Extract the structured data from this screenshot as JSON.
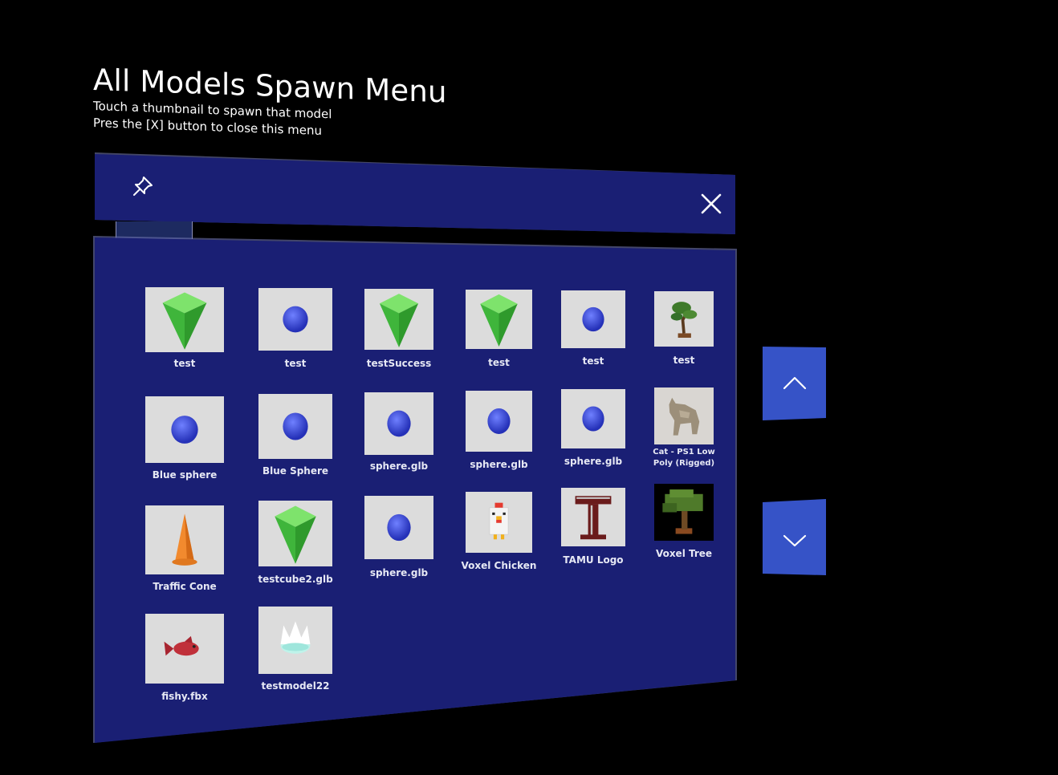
{
  "menu": {
    "title": "All Models Spawn Menu",
    "instructions": [
      "Touch a thumbnail to spawn that model",
      "Pres the [X] button to close this menu"
    ]
  },
  "header": {
    "pin_icon": "pin-icon",
    "close_icon": "close-icon"
  },
  "colors": {
    "panel": "#1a1f74",
    "thumbnail_bg": "#dcdcdc",
    "scroll_button": "#3653c7",
    "cube_green": "#4fd04a",
    "sphere_blue": "#3b4fd8"
  },
  "models": [
    {
      "label": "test",
      "icon": "green-cube-icon"
    },
    {
      "label": "test",
      "icon": "blue-sphere-icon"
    },
    {
      "label": "testSuccess",
      "icon": "green-cube-icon"
    },
    {
      "label": "test",
      "icon": "green-cube-icon"
    },
    {
      "label": "test",
      "icon": "blue-sphere-icon"
    },
    {
      "label": "test",
      "icon": "bonsai-tree-icon"
    },
    {
      "label": "Blue sphere",
      "icon": "blue-sphere-icon"
    },
    {
      "label": "Blue Sphere",
      "icon": "blue-sphere-icon"
    },
    {
      "label": "sphere.glb",
      "icon": "blue-sphere-icon"
    },
    {
      "label": "sphere.glb",
      "icon": "blue-sphere-icon"
    },
    {
      "label": "sphere.glb",
      "icon": "blue-sphere-icon"
    },
    {
      "label": "Cat - PS1 Low Poly (Rigged)",
      "icon": "cat-icon"
    },
    {
      "label": "Traffic Cone",
      "icon": "traffic-cone-icon"
    },
    {
      "label": "testcube2.glb",
      "icon": "green-cube-icon"
    },
    {
      "label": "sphere.glb",
      "icon": "blue-sphere-icon"
    },
    {
      "label": "Voxel Chicken",
      "icon": "voxel-chicken-icon"
    },
    {
      "label": "TAMU Logo",
      "icon": "tamu-logo-icon"
    },
    {
      "label": "Voxel Tree",
      "icon": "voxel-tree-icon"
    },
    {
      "label": "fishy.fbx",
      "icon": "fish-icon"
    },
    {
      "label": "testmodel22",
      "icon": "crown-icon"
    }
  ],
  "scroll": {
    "up_icon": "chevron-up-icon",
    "down_icon": "chevron-down-icon"
  }
}
